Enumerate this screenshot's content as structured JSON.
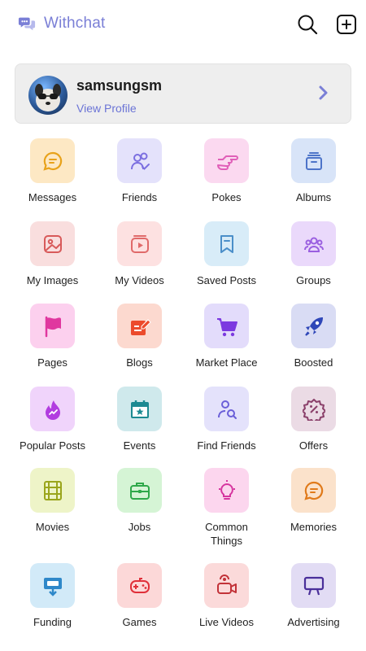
{
  "app": {
    "name": "Withchat"
  },
  "profile": {
    "username": "samsungsm",
    "link_label": "View Profile"
  },
  "colors": {
    "brand": "#7a7fd6",
    "link": "#6b74d6"
  },
  "menu": [
    {
      "label": "Messages",
      "icon": "chat-bubble-icon",
      "bg": "#fde8c4",
      "fg": "#e8a21a"
    },
    {
      "label": "Friends",
      "icon": "friends-icon",
      "bg": "#e4e2fb",
      "fg": "#7b6fe0"
    },
    {
      "label": "Pokes",
      "icon": "pointing-hand-icon",
      "bg": "#fbd9f0",
      "fg": "#e05fb8"
    },
    {
      "label": "Albums",
      "icon": "album-folder-icon",
      "bg": "#d8e4f8",
      "fg": "#4d74c9"
    },
    {
      "label": "My Images",
      "icon": "image-icon",
      "bg": "#f9dede",
      "fg": "#d85a5a"
    },
    {
      "label": "My Videos",
      "icon": "video-icon",
      "bg": "#fde1e1",
      "fg": "#e06a6a"
    },
    {
      "label": "Saved Posts",
      "icon": "bookmark-icon",
      "bg": "#d8ecf8",
      "fg": "#4b8fc9"
    },
    {
      "label": "Groups",
      "icon": "groups-icon",
      "bg": "#ead9fb",
      "fg": "#9a5fe0"
    },
    {
      "label": "Pages",
      "icon": "flag-icon",
      "bg": "#fcd0ee",
      "fg": "#e0379f"
    },
    {
      "label": "Blogs",
      "icon": "blog-edit-icon",
      "bg": "#fcd9cf",
      "fg": "#ec4b2c"
    },
    {
      "label": "Market Place",
      "icon": "cart-icon",
      "bg": "#e3dcfb",
      "fg": "#7c3ae0"
    },
    {
      "label": "Boosted",
      "icon": "rocket-icon",
      "bg": "#d9dcf4",
      "fg": "#2f47b8"
    },
    {
      "label": "Popular Posts",
      "icon": "fire-icon",
      "bg": "#f0d4fb",
      "fg": "#b23de0"
    },
    {
      "label": "Events",
      "icon": "calendar-icon",
      "bg": "#cfe9ec",
      "fg": "#1d8a92"
    },
    {
      "label": "Find Friends",
      "icon": "find-friends-icon",
      "bg": "#e4e2fb",
      "fg": "#6b5fd8"
    },
    {
      "label": "Offers",
      "icon": "discount-badge-icon",
      "bg": "#ebdbe5",
      "fg": "#8a3f6a"
    },
    {
      "label": "Movies",
      "icon": "film-icon",
      "bg": "#eef4c8",
      "fg": "#9aa51c"
    },
    {
      "label": "Jobs",
      "icon": "briefcase-icon",
      "bg": "#d5f4d5",
      "fg": "#2fa84a"
    },
    {
      "label": "Common Things",
      "icon": "lightbulb-icon",
      "bg": "#fcd6ee",
      "fg": "#d6359f"
    },
    {
      "label": "Memories",
      "icon": "memories-chat-icon",
      "bg": "#fbe2cb",
      "fg": "#e07a1a"
    },
    {
      "label": "Funding",
      "icon": "funding-icon",
      "bg": "#d2eaf8",
      "fg": "#2f88c9"
    },
    {
      "label": "Games",
      "icon": "gamepad-icon",
      "bg": "#fcd8d8",
      "fg": "#e0303a"
    },
    {
      "label": "Live Videos",
      "icon": "live-video-icon",
      "bg": "#fbdada",
      "fg": "#c23238"
    },
    {
      "label": "Advertising",
      "icon": "billboard-icon",
      "bg": "#e2dcf4",
      "fg": "#4a2f9a"
    }
  ]
}
